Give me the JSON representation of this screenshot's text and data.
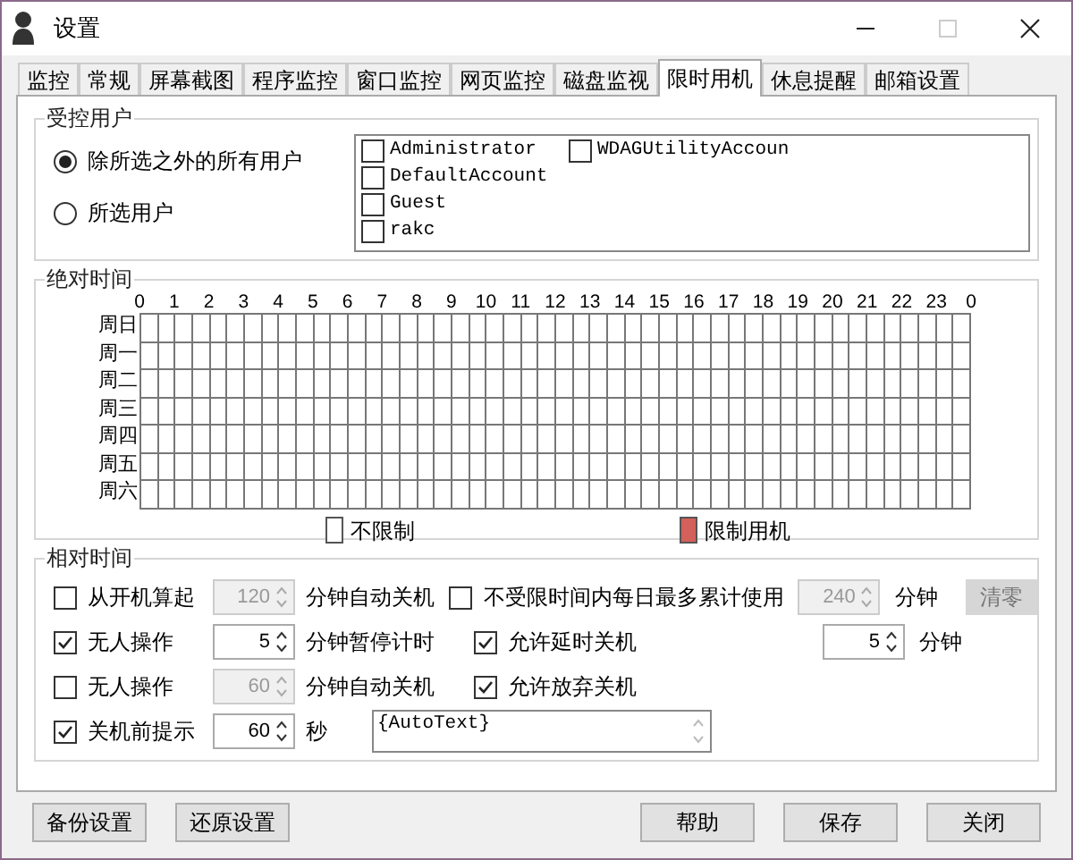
{
  "window": {
    "title": "设置",
    "maximize_disabled": true
  },
  "tabs": [
    {
      "label": "监控",
      "selected": false
    },
    {
      "label": "常规",
      "selected": false
    },
    {
      "label": "屏幕截图",
      "selected": false
    },
    {
      "label": "程序监控",
      "selected": false
    },
    {
      "label": "窗口监控",
      "selected": false
    },
    {
      "label": "网页监控",
      "selected": false
    },
    {
      "label": "磁盘监视",
      "selected": false
    },
    {
      "label": "限时用机",
      "selected": true
    },
    {
      "label": "休息提醒",
      "selected": false
    },
    {
      "label": "邮箱设置",
      "selected": false
    }
  ],
  "controlled_users": {
    "title": "受控用户",
    "modes": [
      {
        "label": "除所选之外的所有用户",
        "selected": true
      },
      {
        "label": "所选用户",
        "selected": false
      }
    ],
    "users": [
      {
        "name": "Administrator",
        "checked": false
      },
      {
        "name": "DefaultAccount",
        "checked": false
      },
      {
        "name": "Guest",
        "checked": false
      },
      {
        "name": "rakc",
        "checked": false
      },
      {
        "name": "WDAGUtilityAccoun",
        "checked": false
      }
    ]
  },
  "absolute_time": {
    "title": "绝对时间",
    "hours": [
      "0",
      "1",
      "2",
      "3",
      "4",
      "5",
      "6",
      "7",
      "8",
      "9",
      "10",
      "11",
      "12",
      "13",
      "14",
      "15",
      "16",
      "17",
      "18",
      "19",
      "20",
      "21",
      "22",
      "23",
      "0"
    ],
    "days": [
      {
        "label": "周日",
        "slots": [
          false,
          false,
          false,
          false,
          false,
          false,
          false,
          false,
          false,
          false,
          false,
          false,
          false,
          false,
          false,
          false,
          false,
          false,
          false,
          false,
          false,
          false,
          false,
          false,
          false,
          false,
          false,
          false,
          false,
          false,
          false,
          false,
          false,
          false,
          false,
          false,
          false,
          false,
          false,
          false,
          false,
          false,
          false,
          false,
          false,
          false,
          false,
          false
        ]
      },
      {
        "label": "周一",
        "slots": [
          false,
          false,
          false,
          false,
          false,
          false,
          false,
          false,
          false,
          false,
          false,
          false,
          false,
          false,
          false,
          false,
          false,
          false,
          false,
          false,
          false,
          false,
          false,
          false,
          false,
          false,
          false,
          false,
          false,
          false,
          false,
          false,
          false,
          false,
          false,
          false,
          false,
          false,
          false,
          false,
          false,
          false,
          false,
          false,
          false,
          false,
          false,
          false
        ]
      },
      {
        "label": "周二",
        "slots": [
          false,
          false,
          false,
          false,
          false,
          false,
          false,
          false,
          false,
          false,
          false,
          false,
          false,
          false,
          false,
          false,
          false,
          false,
          false,
          false,
          false,
          false,
          false,
          false,
          false,
          false,
          false,
          false,
          false,
          false,
          false,
          false,
          false,
          false,
          false,
          false,
          false,
          false,
          false,
          false,
          false,
          false,
          false,
          false,
          false,
          false,
          false,
          false
        ]
      },
      {
        "label": "周三",
        "slots": [
          false,
          false,
          false,
          false,
          false,
          false,
          false,
          false,
          false,
          false,
          false,
          false,
          false,
          false,
          false,
          false,
          false,
          false,
          false,
          false,
          false,
          false,
          false,
          false,
          false,
          false,
          false,
          false,
          false,
          false,
          false,
          false,
          false,
          false,
          false,
          false,
          false,
          false,
          false,
          false,
          false,
          false,
          false,
          false,
          false,
          false,
          false,
          false
        ]
      },
      {
        "label": "周四",
        "slots": [
          false,
          false,
          false,
          false,
          false,
          false,
          false,
          false,
          false,
          false,
          false,
          false,
          false,
          false,
          false,
          false,
          false,
          false,
          false,
          false,
          false,
          false,
          false,
          false,
          false,
          false,
          false,
          false,
          false,
          false,
          false,
          false,
          false,
          false,
          false,
          false,
          false,
          false,
          false,
          false,
          false,
          false,
          false,
          false,
          false,
          false,
          false,
          false
        ]
      },
      {
        "label": "周五",
        "slots": [
          false,
          false,
          false,
          false,
          false,
          false,
          false,
          false,
          false,
          false,
          false,
          false,
          false,
          false,
          false,
          false,
          false,
          false,
          false,
          false,
          false,
          false,
          false,
          false,
          false,
          false,
          false,
          false,
          false,
          false,
          false,
          false,
          false,
          false,
          false,
          false,
          false,
          false,
          false,
          false,
          false,
          false,
          false,
          false,
          false,
          false,
          false,
          false
        ]
      },
      {
        "label": "周六",
        "slots": [
          false,
          false,
          false,
          false,
          false,
          false,
          false,
          false,
          false,
          false,
          false,
          false,
          false,
          false,
          false,
          false,
          false,
          false,
          false,
          false,
          false,
          false,
          false,
          false,
          false,
          false,
          false,
          false,
          false,
          false,
          false,
          false,
          false,
          false,
          false,
          false,
          false,
          false,
          false,
          false,
          false,
          false,
          false,
          false,
          false,
          false,
          false,
          false
        ]
      }
    ],
    "legend": [
      {
        "label": "不限制",
        "color": "#ffffff"
      },
      {
        "label": "限制用机",
        "color": "#d3605a"
      }
    ]
  },
  "relative_time": {
    "title": "相对时间",
    "left": [
      {
        "label": "从开机算起",
        "checked": false,
        "value": "120",
        "disabled": true,
        "unit": "分钟自动关机"
      },
      {
        "label": "无人操作",
        "checked": true,
        "value": "5",
        "disabled": false,
        "unit": "分钟暂停计时"
      },
      {
        "label": "无人操作",
        "checked": false,
        "value": "60",
        "disabled": true,
        "unit": "分钟自动关机"
      },
      {
        "label": "关机前提示",
        "checked": true,
        "value": "60",
        "disabled": false,
        "unit": "秒"
      }
    ],
    "right": [
      {
        "label": "不受限时间内每日最多累计使用",
        "checked": false,
        "value": "240",
        "disabled": true,
        "unit": "分钟"
      },
      {
        "label": "允许延时关机",
        "checked": true,
        "value": "5",
        "disabled": false,
        "unit": "分钟"
      },
      {
        "label": "允许放弃关机",
        "checked": true
      }
    ],
    "reset_button": {
      "label": "清零",
      "disabled": true
    },
    "message": "{AutoText}"
  },
  "buttons_left": [
    "备份设置",
    "还原设置"
  ],
  "buttons_right": [
    "帮助",
    "保存",
    "关闭"
  ]
}
